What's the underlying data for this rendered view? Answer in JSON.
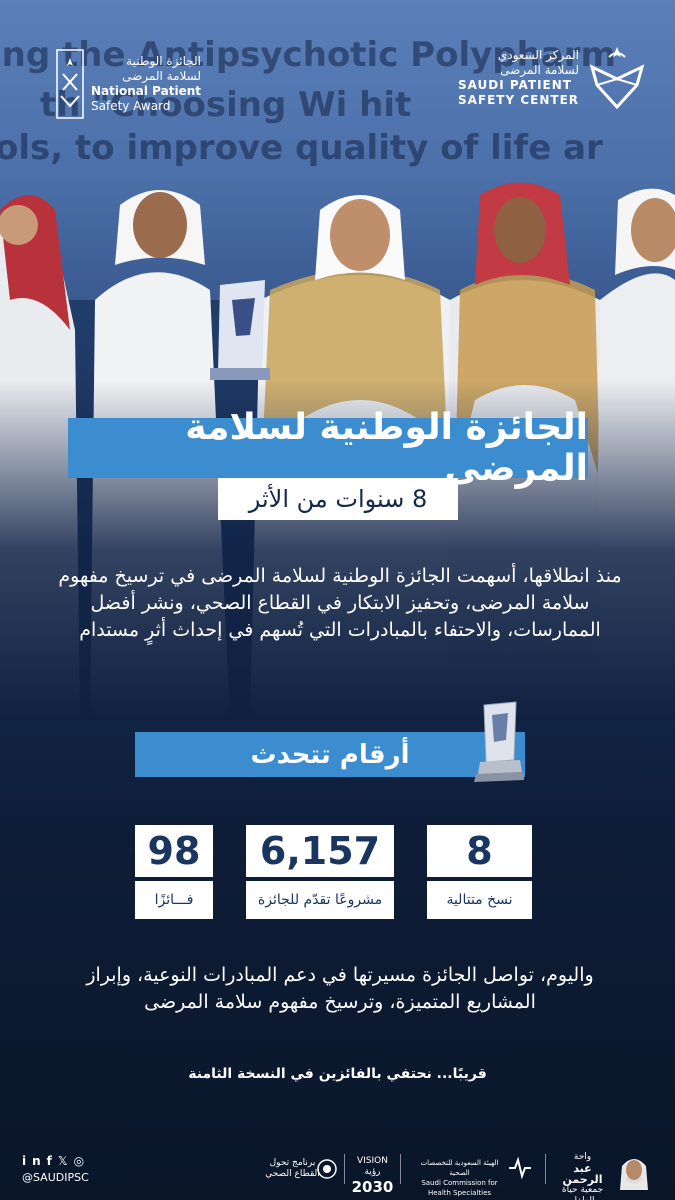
{
  "header": {
    "right_logo": {
      "arabic_line1": "المركز السعودي",
      "arabic_line2": "لسلامة المرضى",
      "english_line1": "SAUDI PATIENT",
      "english_line2": "SAFETY CENTER"
    },
    "left_logo": {
      "arabic_line1": "الجائزة الوطنية",
      "arabic_line2": "لسلامة المرضى",
      "english_line1": "National Patient",
      "english_line2": "Safety Award"
    }
  },
  "background_text": {
    "line1": "ing the Antipsychotic Polypharm",
    "line2": "th      \"Choosing Wi     hit",
    "line3": "ols, to improve quality of life ar"
  },
  "title": "الجائزة الوطنية لسلامة المرضى",
  "subtitle": "8 سنوات من الأثر",
  "intro": "منذ انطلاقها، أسهمت الجائزة الوطنية لسلامة المرضى في ترسيخ مفهوم سلامة المرضى، وتحفيز الابتكار في القطاع الصحي، ونشر أفضل الممارسات، والاحتفاء بالمبادرات التي تُسهم في إحداث أثرٍ مستدام",
  "numbers_heading": "أرقام تتحدث",
  "stats": [
    {
      "value": "8",
      "label": "نسخ متتالية"
    },
    {
      "value": "6,157",
      "label": "مشروعًا تقدّم للجائزة"
    },
    {
      "value": "98",
      "label": "فـــائزًا"
    }
  ],
  "outro": "واليوم، تواصل الجائزة مسيرتها في دعم المبادرات النوعية، وإبراز المشاريع المتميزة، وترسيخ مفهوم سلامة المرضى",
  "soon": "قريبًا... نحتفي بالفائزين في النسخة الثامنة",
  "footer": {
    "handle": "@SAUDIPSC",
    "social_icons": [
      "linkedin-icon",
      "facebook-icon",
      "x-icon",
      "instagram-icon"
    ],
    "program_logo_line1": "برنامج تحول",
    "program_logo_line2": "القطاع الصحي",
    "vision_line1": "VISION رؤية",
    "vision_line2": "2030",
    "commission_line1": "الهيئة السعودية للتخصصات الصحية",
    "commission_line2": "Saudi Commission for Health Specialties",
    "oasis_line1": "واحة",
    "oasis_line2": "عبد الرحمن",
    "oasis_line3": "جمعية حياة الطفل"
  },
  "colors": {
    "accent_blue": "#3b8dcf",
    "navy": "#14284a",
    "white": "#ffffff"
  }
}
